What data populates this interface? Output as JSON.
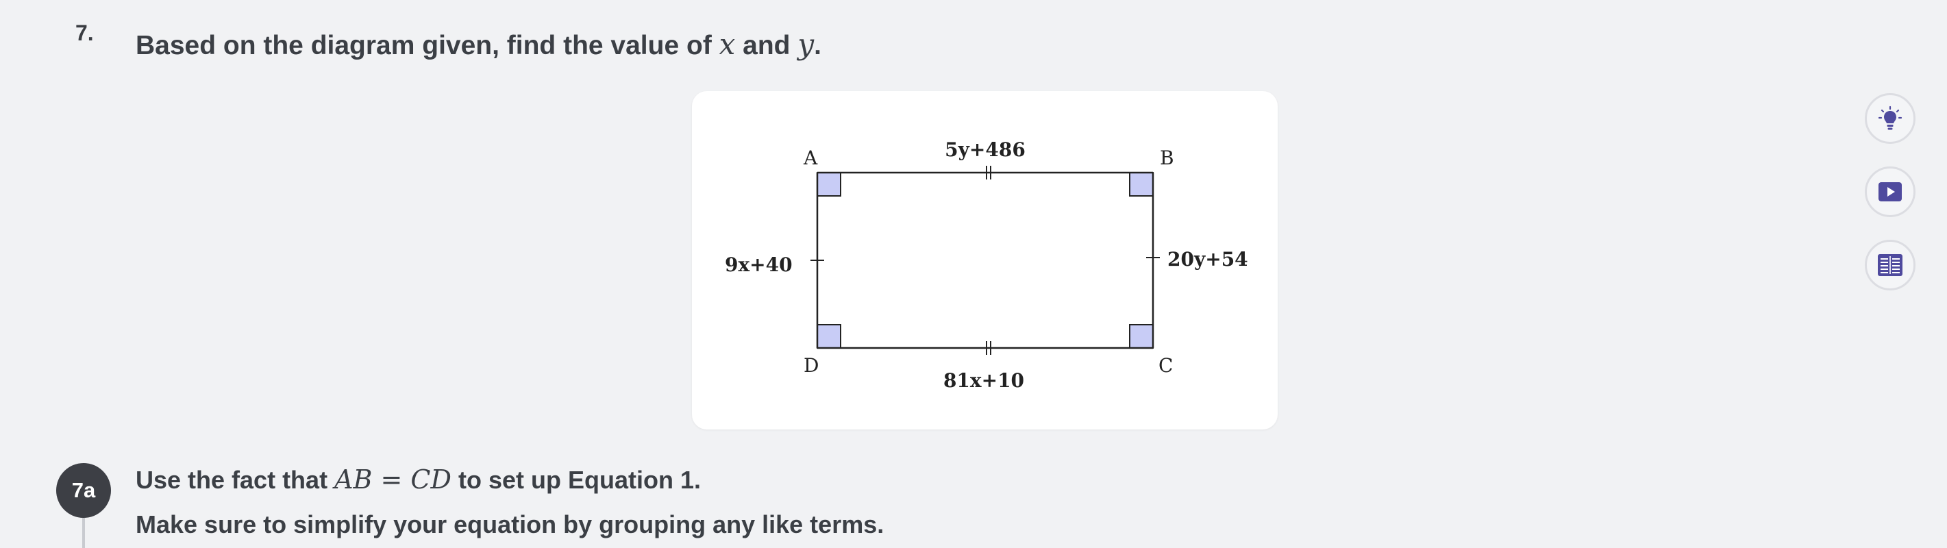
{
  "question": {
    "number": "7.",
    "text_before": "Based on the diagram given, find the value of ",
    "var_x": "x",
    "and_word": " and ",
    "var_y": "y",
    "text_end": "."
  },
  "diagram": {
    "vertices": {
      "a": "A",
      "b": "B",
      "c": "C",
      "d": "D"
    },
    "edges": {
      "top": "5y+486",
      "right": "20y+54",
      "bottom": "81x+10",
      "left": "9x+40"
    },
    "right_angle_fill": "#c8ccf6",
    "stroke_color": "#222222"
  },
  "tools": {
    "hint_icon": "lightbulb-icon",
    "video_icon": "play-icon",
    "reference_icon": "formula-sheet-icon",
    "accent_color": "#4f4a9e"
  },
  "step": {
    "label": "7a",
    "line1_before": "Use the fact that ",
    "line1_math": "AB = CD",
    "line1_after": " to set up Equation 1.",
    "line2": "Make sure to simplify your equation by grouping any like terms."
  }
}
